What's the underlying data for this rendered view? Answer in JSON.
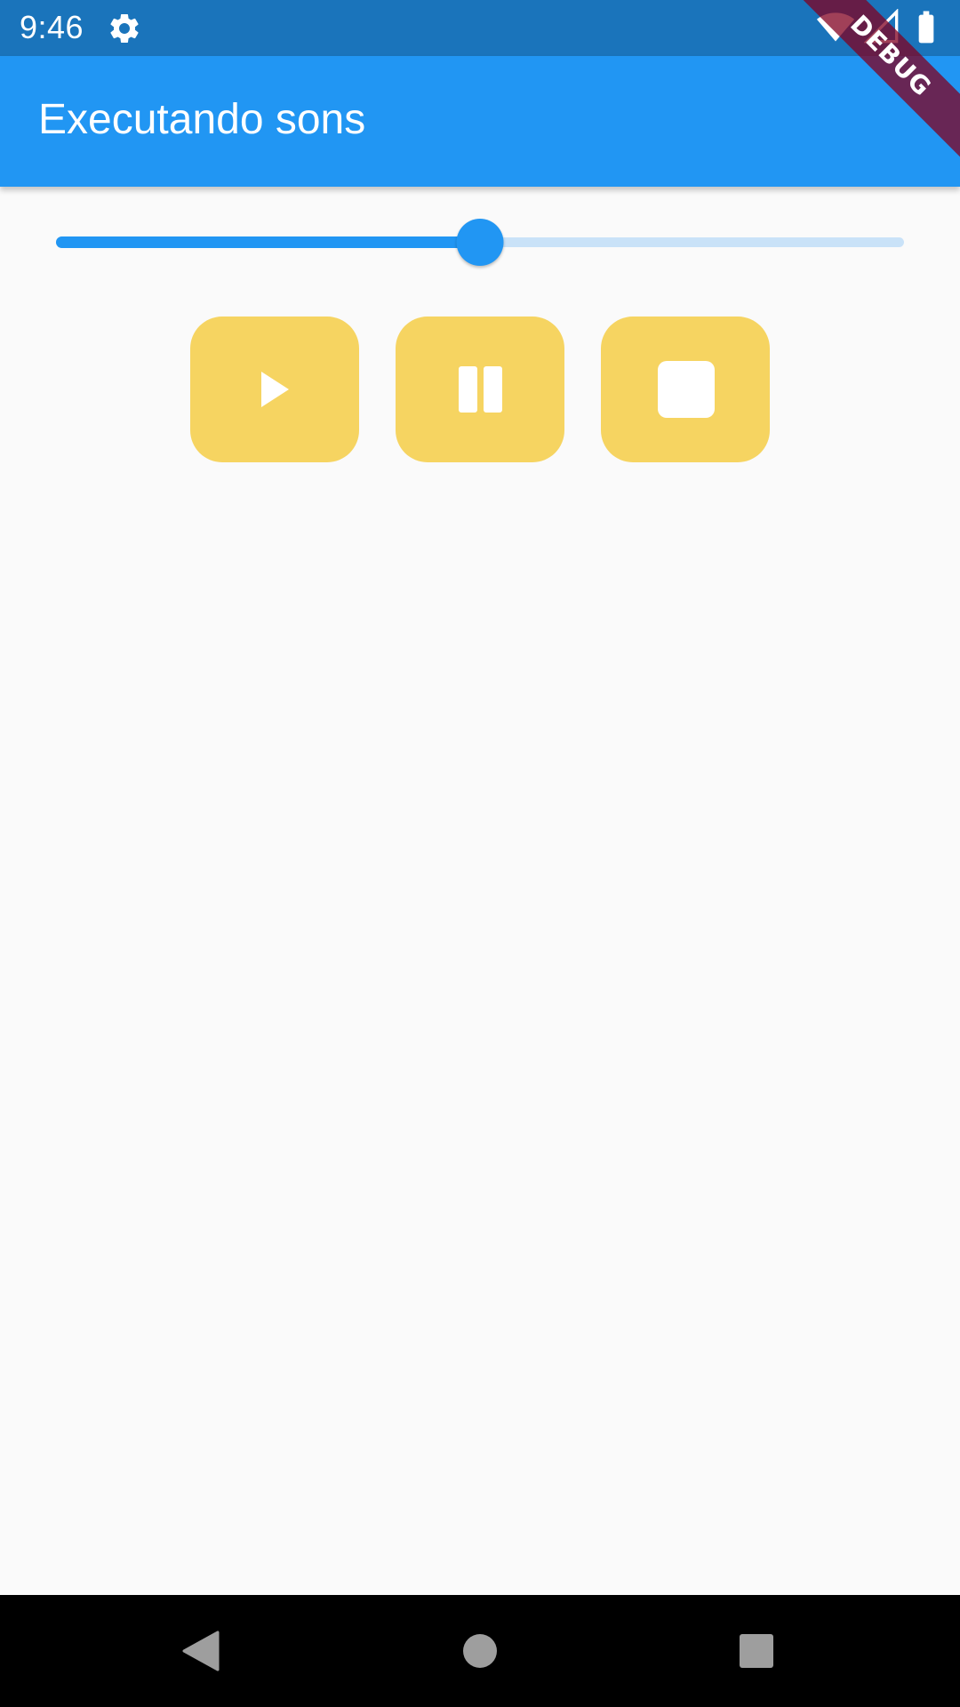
{
  "status_bar": {
    "time": "9:46",
    "icons": [
      "settings-gear-icon",
      "wifi-icon",
      "cell-signal-icon",
      "battery-icon"
    ]
  },
  "app_bar": {
    "title": "Executando sons",
    "color": "#2196f3"
  },
  "debug_banner": "DEBUG",
  "volume_slider": {
    "value_fraction": 0.5,
    "active_color": "#2196f3",
    "inactive_color": "#c9e2f8"
  },
  "controls": {
    "button_color": "#f6d461",
    "buttons": [
      {
        "name": "play",
        "icon": "play-icon"
      },
      {
        "name": "pause",
        "icon": "pause-icon"
      },
      {
        "name": "stop",
        "icon": "stop-icon"
      }
    ]
  },
  "nav_bar": {
    "buttons": [
      "back-icon",
      "home-icon",
      "recents-icon"
    ]
  }
}
